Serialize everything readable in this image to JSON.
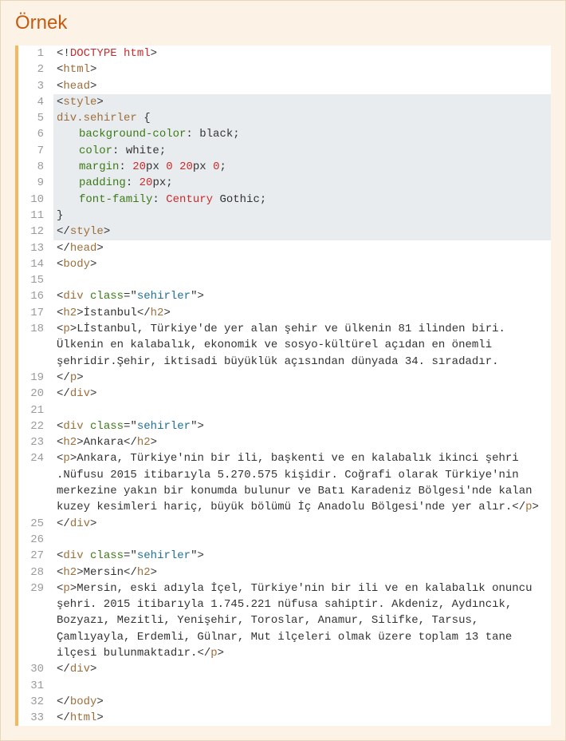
{
  "title": "Örnek",
  "lines": [
    {
      "n": 1,
      "hl": false,
      "html": "<span class='p'>&lt;!</span><span class='dt'>DOCTYPE html</span><span class='p'>&gt;</span>"
    },
    {
      "n": 2,
      "hl": false,
      "html": "<span class='p'>&lt;</span><span class='tg'>html</span><span class='p'>&gt;</span>"
    },
    {
      "n": 3,
      "hl": false,
      "html": "<span class='p'>&lt;</span><span class='tg'>head</span><span class='p'>&gt;</span>"
    },
    {
      "n": 4,
      "hl": true,
      "html": "<span class='p'>&lt;</span><span class='tg'>style</span><span class='p'>&gt;</span>"
    },
    {
      "n": 5,
      "hl": true,
      "html": "<span class='sel'>div</span><span class='cls'>.sehirler</span> <span class='p'>{</span>"
    },
    {
      "n": 6,
      "hl": true,
      "html": "<span class='indent'><span class='pr'>background-color</span><span class='p'>:</span> <span class='vl'>black</span><span class='p'>;</span></span>"
    },
    {
      "n": 7,
      "hl": true,
      "html": "<span class='indent'><span class='pr'>color</span><span class='p'>:</span> <span class='vl'>white</span><span class='p'>;</span></span>"
    },
    {
      "n": 8,
      "hl": true,
      "html": "<span class='indent'><span class='pr'>margin</span><span class='p'>:</span> <span class='nm'>20</span><span class='vl'>px</span> <span class='nm'>0</span> <span class='nm'>20</span><span class='vl'>px</span> <span class='nm'>0</span><span class='p'>;</span></span>"
    },
    {
      "n": 9,
      "hl": true,
      "html": "<span class='indent'><span class='pr'>padding</span><span class='p'>:</span> <span class='nm'>20</span><span class='vl'>px</span><span class='p'>;</span></span>"
    },
    {
      "n": 10,
      "hl": true,
      "html": "<span class='indent'><span class='pr'>font-family</span><span class='p'>:</span> <span class='hword'>Century</span> <span class='vl'>Gothic</span><span class='p'>;</span></span>"
    },
    {
      "n": 11,
      "hl": true,
      "html": "<span class='p'>}</span>"
    },
    {
      "n": 12,
      "hl": true,
      "html": "<span class='p'>&lt;/</span><span class='tg'>style</span><span class='p'>&gt;</span>"
    },
    {
      "n": 13,
      "hl": false,
      "html": "<span class='p'>&lt;/</span><span class='tg'>head</span><span class='p'>&gt;</span>"
    },
    {
      "n": 14,
      "hl": false,
      "html": "<span class='p'>&lt;</span><span class='tg'>body</span><span class='p'>&gt;</span>"
    },
    {
      "n": 15,
      "hl": false,
      "html": " "
    },
    {
      "n": 16,
      "hl": false,
      "html": "<span class='p'>&lt;</span><span class='tg'>div</span> <span class='at'>class</span><span class='p'>=</span><span class='p'>\"</span><span class='av'>sehirler</span><span class='p'>\"</span><span class='p'>&gt;</span>"
    },
    {
      "n": 17,
      "hl": false,
      "html": "<span class='p'>&lt;</span><span class='tg'>h2</span><span class='p'>&gt;</span>İstanbul<span class='p'>&lt;/</span><span class='tg'>h2</span><span class='p'>&gt;</span>"
    },
    {
      "n": 18,
      "hl": false,
      "html": "<span class='p'>&lt;</span><span class='tg'>p</span><span class='p'>&gt;</span>Lİstanbul, Türkiye'de yer alan şehir ve ülkenin 81 ilinden biri. Ülkenin en kalabalık, ekonomik ve sosyo-kültürel açıdan en önemli şehridir.Şehir, iktisadi büyüklük açısından dünyada 34. sıradadır."
    },
    {
      "n": 19,
      "hl": false,
      "html": "<span class='p'>&lt;/</span><span class='tg'>p</span><span class='p'>&gt;</span>"
    },
    {
      "n": 20,
      "hl": false,
      "html": "<span class='p'>&lt;/</span><span class='tg'>div</span><span class='p'>&gt;</span>"
    },
    {
      "n": 21,
      "hl": false,
      "html": " "
    },
    {
      "n": 22,
      "hl": false,
      "html": "<span class='p'>&lt;</span><span class='tg'>div</span> <span class='at'>class</span><span class='p'>=</span><span class='p'>\"</span><span class='av'>sehirler</span><span class='p'>\"</span><span class='p'>&gt;</span>"
    },
    {
      "n": 23,
      "hl": false,
      "html": "<span class='p'>&lt;</span><span class='tg'>h2</span><span class='p'>&gt;</span>Ankara<span class='p'>&lt;/</span><span class='tg'>h2</span><span class='p'>&gt;</span>"
    },
    {
      "n": 24,
      "hl": false,
      "html": "<span class='p'>&lt;</span><span class='tg'>p</span><span class='p'>&gt;</span>Ankara, Türkiye'nin bir ili, başkenti ve en kalabalık ikinci şehri .Nüfusu 2015 itibarıyla 5.270.575 kişidir. Coğrafi olarak Türkiye'nin merkezine yakın bir konumda bulunur ve Batı Karadeniz Bölgesi'nde kalan kuzey kesimleri hariç, büyük bölümü İç Anadolu Bölgesi'nde yer alır.<span class='p'>&lt;/</span><span class='tg'>p</span><span class='p'>&gt;</span>"
    },
    {
      "n": 25,
      "hl": false,
      "html": "<span class='p'>&lt;/</span><span class='tg'>div</span><span class='p'>&gt;</span>"
    },
    {
      "n": 26,
      "hl": false,
      "html": " "
    },
    {
      "n": 27,
      "hl": false,
      "html": "<span class='p'>&lt;</span><span class='tg'>div</span> <span class='at'>class</span><span class='p'>=</span><span class='p'>\"</span><span class='av'>sehirler</span><span class='p'>\"</span><span class='p'>&gt;</span>"
    },
    {
      "n": 28,
      "hl": false,
      "html": "<span class='p'>&lt;</span><span class='tg'>h2</span><span class='p'>&gt;</span>Mersin<span class='p'>&lt;/</span><span class='tg'>h2</span><span class='p'>&gt;</span>"
    },
    {
      "n": 29,
      "hl": false,
      "html": "<span class='p'>&lt;</span><span class='tg'>p</span><span class='p'>&gt;</span>Mersin, eski adıyla İçel, Türkiye'nin bir ili ve en kalabalık onuncu şehri. 2015 itibarıyla 1.745.221 nüfusa sahiptir. Akdeniz, Aydıncık, Bozyazı, Mezitli, Yenişehir, Toroslar, Anamur, Silifke, Tarsus, Çamlıyayla, Erdemli, Gülnar, Mut ilçeleri olmak üzere toplam 13 tane ilçesi bulunmaktadır.<span class='p'>&lt;/</span><span class='tg'>p</span><span class='p'>&gt;</span>"
    },
    {
      "n": 30,
      "hl": false,
      "html": "<span class='p'>&lt;/</span><span class='tg'>div</span><span class='p'>&gt;</span>"
    },
    {
      "n": 31,
      "hl": false,
      "html": " "
    },
    {
      "n": 32,
      "hl": false,
      "html": "<span class='p'>&lt;/</span><span class='tg'>body</span><span class='p'>&gt;</span>"
    },
    {
      "n": 33,
      "hl": false,
      "html": "<span class='p'>&lt;/</span><span class='tg'>html</span><span class='p'>&gt;</span>"
    }
  ]
}
